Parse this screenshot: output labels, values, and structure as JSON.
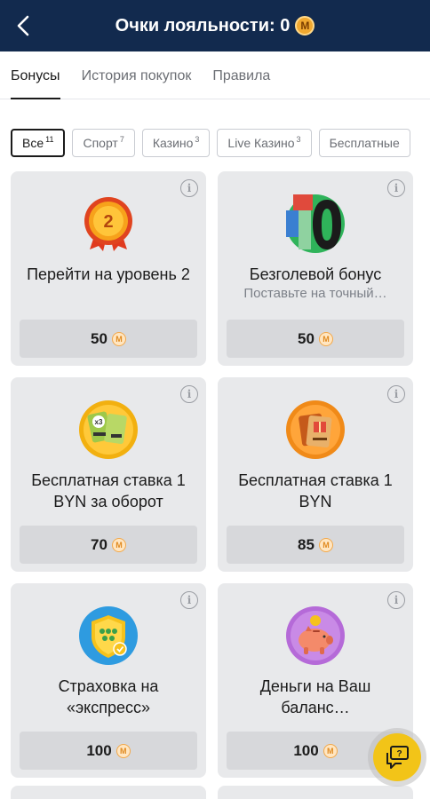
{
  "header": {
    "title": "Очки лояльности: 0",
    "coin_symbol": "M"
  },
  "tabs": [
    {
      "label": "Бонусы",
      "active": true
    },
    {
      "label": "История покупок",
      "active": false
    },
    {
      "label": "Правила",
      "active": false
    }
  ],
  "filters": [
    {
      "label": "Все",
      "count": "11",
      "active": true
    },
    {
      "label": "Спорт",
      "count": "7",
      "active": false
    },
    {
      "label": "Казино",
      "count": "3",
      "active": false
    },
    {
      "label": "Live Казино",
      "count": "3",
      "active": false
    },
    {
      "label": "Бесплатные",
      "count": "",
      "active": false
    }
  ],
  "cards": [
    {
      "icon": "level-2-medal-icon",
      "title": "Перейти на уровень 2",
      "subtitle": "",
      "price": "50"
    },
    {
      "icon": "zero-margin-icon",
      "title": "Безголевой бонус",
      "subtitle": "Поставьте на точный…",
      "price": "50"
    },
    {
      "icon": "free-bet-turnover-icon",
      "title": "Бесплатная ставка 1 BYN за оборот",
      "subtitle": "",
      "price": "70"
    },
    {
      "icon": "free-bet-gift-icon",
      "title": "Бесплатная ставка 1 BYN",
      "subtitle": "",
      "price": "85"
    },
    {
      "icon": "express-insurance-shield-icon",
      "title": "Страховка на «экспресс»",
      "subtitle": "",
      "price": "100"
    },
    {
      "icon": "piggy-bank-icon",
      "title": "Деньги на Ваш баланс…",
      "subtitle": "",
      "price": "100"
    }
  ],
  "info_symbol": "i",
  "colors": {
    "header_bg": "#122a4e",
    "card_bg": "#e8e9eb",
    "coin_accent": "#f2a84a",
    "chat_button": "#f2c418"
  }
}
